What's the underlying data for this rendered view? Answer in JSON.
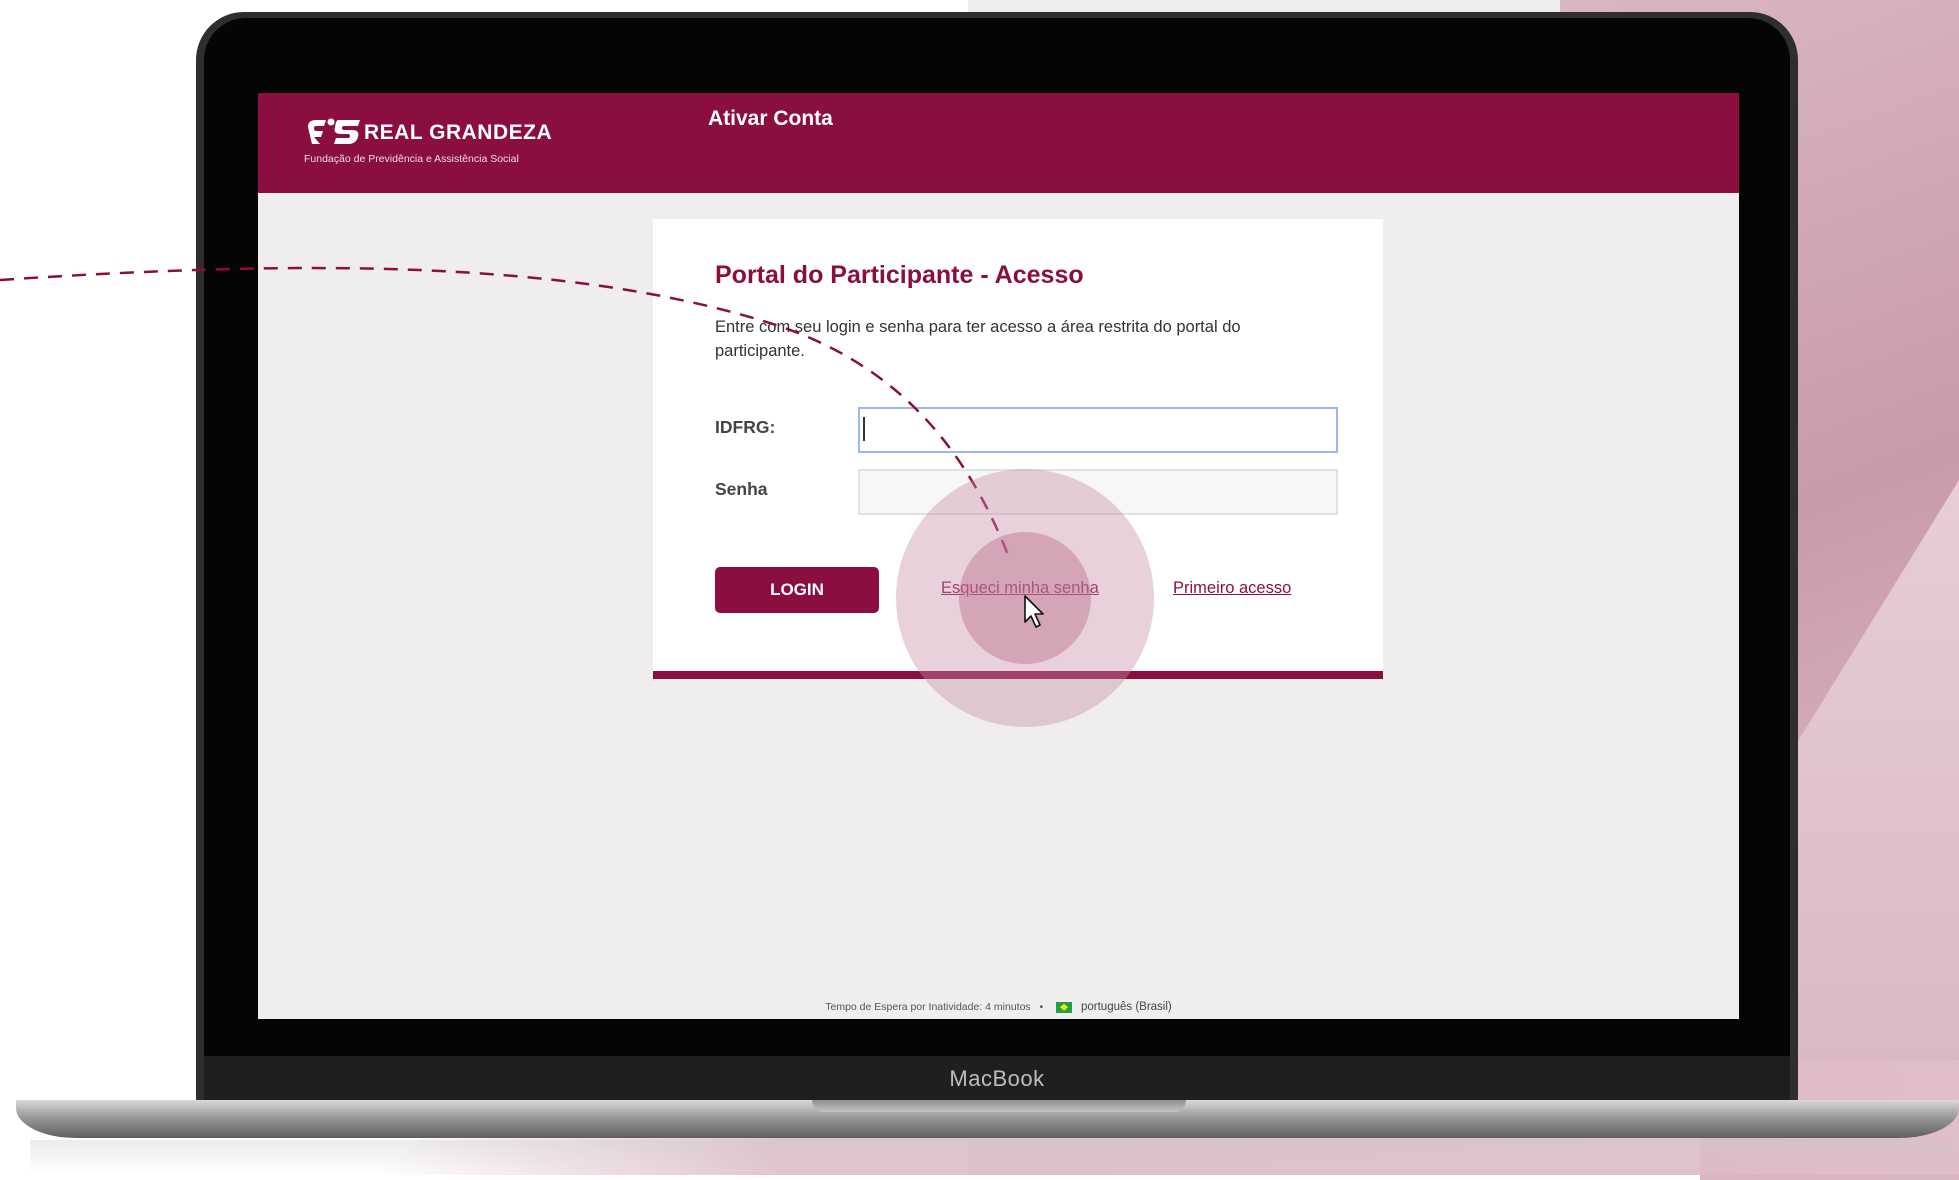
{
  "header": {
    "logo_name": "REAL GRANDEZA",
    "logo_tagline": "Fundação de Previdência e Assistência Social",
    "page_title": "Ativar Conta"
  },
  "login_card": {
    "title": "Portal do Participante - Acesso",
    "description": "Entre com seu login e senha para ter acesso a área restrita do portal do participante.",
    "id_label": "IDFRG:",
    "id_value": "",
    "password_label": "Senha",
    "password_value": "",
    "login_button": "LOGIN",
    "forgot_password_link": "Esqueci minha senha",
    "first_access_link": "Primeiro acesso"
  },
  "footer": {
    "timeout_text": "Tempo de Espera por Inatividade: 4 minutos",
    "separator": "•",
    "language": "português (Brasil)",
    "flag_icon": "brazil-flag-icon"
  },
  "device": {
    "label": "MacBook"
  },
  "colors": {
    "brand": "#8a0f40",
    "screen_bg": "#efeeec",
    "focus_border": "#9db7ea"
  }
}
